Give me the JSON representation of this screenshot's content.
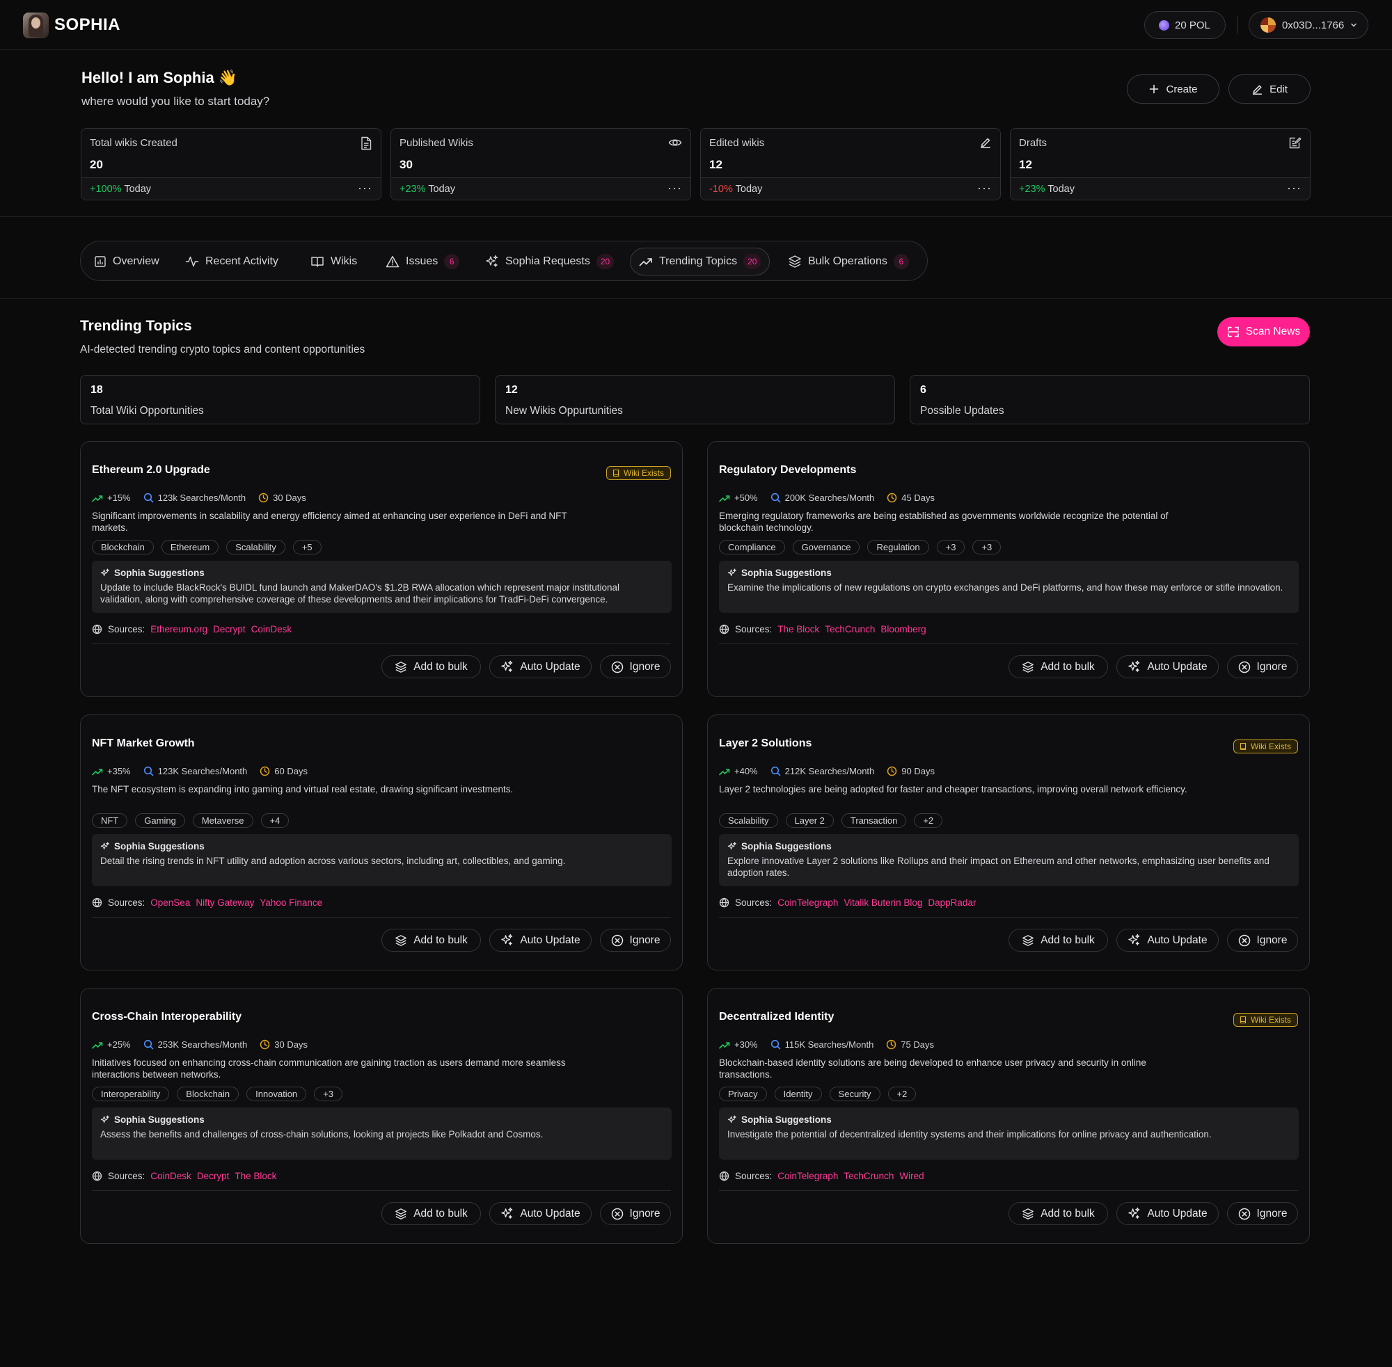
{
  "app": {
    "name": "SOPHIA"
  },
  "header": {
    "balance": "20 POL",
    "wallet": "0x03D...1766"
  },
  "greeting": {
    "title": "Hello! I am Sophia 👋",
    "subtitle": "where would you like to start today?"
  },
  "actions": {
    "create": "Create",
    "edit": "Edit"
  },
  "stats": [
    {
      "label": "Total wikis Created",
      "value": "20",
      "change": "+100%",
      "period": "Today",
      "trend": "up",
      "icon": "document-icon"
    },
    {
      "label": "Published Wikis",
      "value": "30",
      "change": "+23%",
      "period": "Today",
      "trend": "up",
      "icon": "eye-icon"
    },
    {
      "label": "Edited wikis",
      "value": "12",
      "change": "-10%",
      "period": "Today",
      "trend": "down",
      "icon": "pencil-icon"
    },
    {
      "label": "Drafts",
      "value": "12",
      "change": "+23%",
      "period": "Today",
      "trend": "up",
      "icon": "draft-icon"
    }
  ],
  "tabs": [
    {
      "label": "Overview",
      "icon": "chart-icon"
    },
    {
      "label": "Recent Activity",
      "icon": "activity-icon"
    },
    {
      "label": "Wikis",
      "icon": "book-icon"
    },
    {
      "label": "Issues",
      "badge": "6",
      "icon": "warning-icon"
    },
    {
      "label": "Sophia Requests",
      "badge": "20",
      "icon": "sparkles-icon"
    },
    {
      "label": "Trending Topics",
      "badge": "20",
      "icon": "trending-icon",
      "active": true
    },
    {
      "label": "Bulk Operations",
      "badge": "6",
      "icon": "layers-icon"
    }
  ],
  "section": {
    "title": "Trending Topics",
    "subtitle": "AI-detected trending crypto topics and content opportunities",
    "scan_label": "Scan News",
    "accent": "#ff1f8e"
  },
  "opportunities": [
    {
      "value": "18",
      "label": "Total  Wiki Opportunities"
    },
    {
      "value": "12",
      "label": "New Wikis  Oppurtunities"
    },
    {
      "value": "6",
      "label": "Possible Updates"
    }
  ],
  "card_labels": {
    "wiki_exists": "Wiki Exists",
    "suggestions_title": "Sophia Suggestions",
    "sources_label": "Sources:",
    "add_to_bulk": "Add to  bulk",
    "auto_update": "Auto Update",
    "ignore": "Ignore"
  },
  "topics": [
    {
      "title": "Ethereum 2.0 Upgrade",
      "wiki_exists": true,
      "growth": "+15%",
      "searches": "123k Searches/Month",
      "period": "30 Days",
      "description": "Significant improvements in scalability and energy efficiency aimed at enhancing user experience in DeFi and NFT markets.",
      "tags": [
        "Blockchain",
        "Ethereum",
        "Scalability",
        "+5"
      ],
      "suggestion": "Update to include BlackRock's BUIDL fund launch and MakerDAO's $1.2B RWA allocation which represent major institutional validation, along with comprehensive coverage of these developments and their implications for TradFi-DeFi convergence.",
      "sources": [
        "Ethereum.org",
        "Decrypt",
        "CoinDesk"
      ]
    },
    {
      "title": "Regulatory Developments",
      "wiki_exists": false,
      "growth": "+50%",
      "searches": "200K Searches/Month",
      "period": "45 Days",
      "description": "Emerging regulatory frameworks are being established as governments worldwide recognize the potential of blockchain technology.",
      "tags": [
        "Compliance",
        "Governance",
        "Regulation",
        "+3",
        "+3"
      ],
      "suggestion": "Examine the implications of new regulations on crypto exchanges and DeFi platforms, and how these may enforce or stifle innovation.",
      "sources": [
        "The Block",
        "TechCrunch",
        "Bloomberg"
      ]
    },
    {
      "title": "NFT Market Growth",
      "wiki_exists": false,
      "growth": "+35%",
      "searches": "123K Searches/Month",
      "period": "60 Days",
      "description": "The NFT ecosystem is expanding into gaming and virtual real estate, drawing significant investments.",
      "tags": [
        "NFT",
        "Gaming",
        "Metaverse",
        "+4"
      ],
      "suggestion": "Detail the rising trends in NFT utility and adoption across various sectors, including art, collectibles, and gaming.",
      "sources": [
        "OpenSea",
        "Nifty Gateway",
        "Yahoo Finance"
      ]
    },
    {
      "title": "Layer 2 Solutions",
      "wiki_exists": true,
      "growth": "+40%",
      "searches": "212K Searches/Month",
      "period": "90 Days",
      "description": "Layer 2 technologies are being adopted for faster and cheaper transactions, improving overall network efficiency.",
      "tags": [
        "Scalability",
        "Layer 2",
        "Transaction",
        "+2"
      ],
      "suggestion": "Explore innovative Layer 2 solutions like Rollups and their impact on Ethereum and other networks, emphasizing user benefits and adoption rates.",
      "sources": [
        "CoinTelegraph",
        "Vitalik Buterin Blog",
        "DappRadar"
      ]
    },
    {
      "title": "Cross-Chain Interoperability",
      "wiki_exists": false,
      "growth": "+25%",
      "searches": "253K Searches/Month",
      "period": "30 Days",
      "description": "Initiatives focused on enhancing cross-chain communication are gaining traction as users demand more seamless interactions between networks.",
      "tags": [
        "Interoperability",
        "Blockchain",
        "Innovation",
        "+3"
      ],
      "suggestion": "Assess the benefits and challenges of cross-chain solutions, looking at projects like Polkadot and Cosmos.",
      "sources": [
        "CoinDesk",
        "Decrypt",
        "The Block"
      ]
    },
    {
      "title": "Decentralized Identity",
      "wiki_exists": true,
      "growth": "+30%",
      "searches": "115K Searches/Month",
      "period": "75 Days",
      "description": "Blockchain-based identity solutions are being developed to enhance user privacy and security in online transactions.",
      "tags": [
        "Privacy",
        "Identity",
        "Security",
        "+2"
      ],
      "suggestion": "Investigate the potential of decentralized identity systems and their implications for online privacy and authentication.",
      "sources": [
        "CoinTelegraph",
        "TechCrunch",
        "Wired"
      ]
    }
  ],
  "colors": {
    "positive": "#22c55e",
    "negative": "#ef4444",
    "link": "#ff3a95",
    "wiki_badge": "#e1b62f"
  }
}
